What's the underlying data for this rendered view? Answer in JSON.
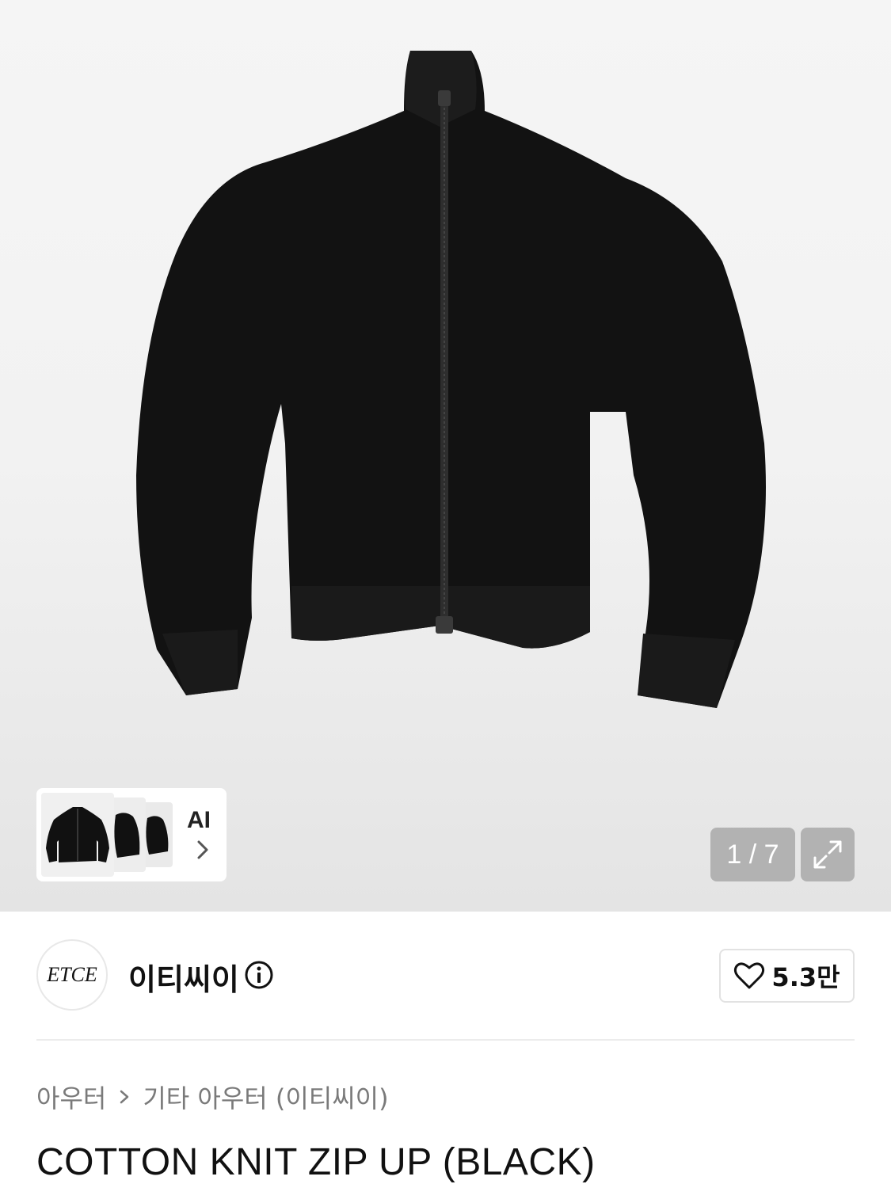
{
  "gallery": {
    "current": "1",
    "total": "7",
    "counter_text": "1 / 7",
    "ai_label": "AI"
  },
  "brand": {
    "logo_text": "ETCE",
    "name": "이티씨이"
  },
  "like": {
    "count": "5.3만"
  },
  "breadcrumb": {
    "level1": "아우터",
    "level2": "기타 아우터 (이티씨이)"
  },
  "product": {
    "title": "COTTON KNIT ZIP UP (BLACK)"
  },
  "icons": {
    "chevron": "chevron-right-icon",
    "expand": "expand-icon",
    "info": "info-icon",
    "heart": "heart-icon"
  },
  "colors": {
    "garment": "#121212",
    "overlay_button": "#969696",
    "breadcrumb_text": "#7a7a7a"
  }
}
